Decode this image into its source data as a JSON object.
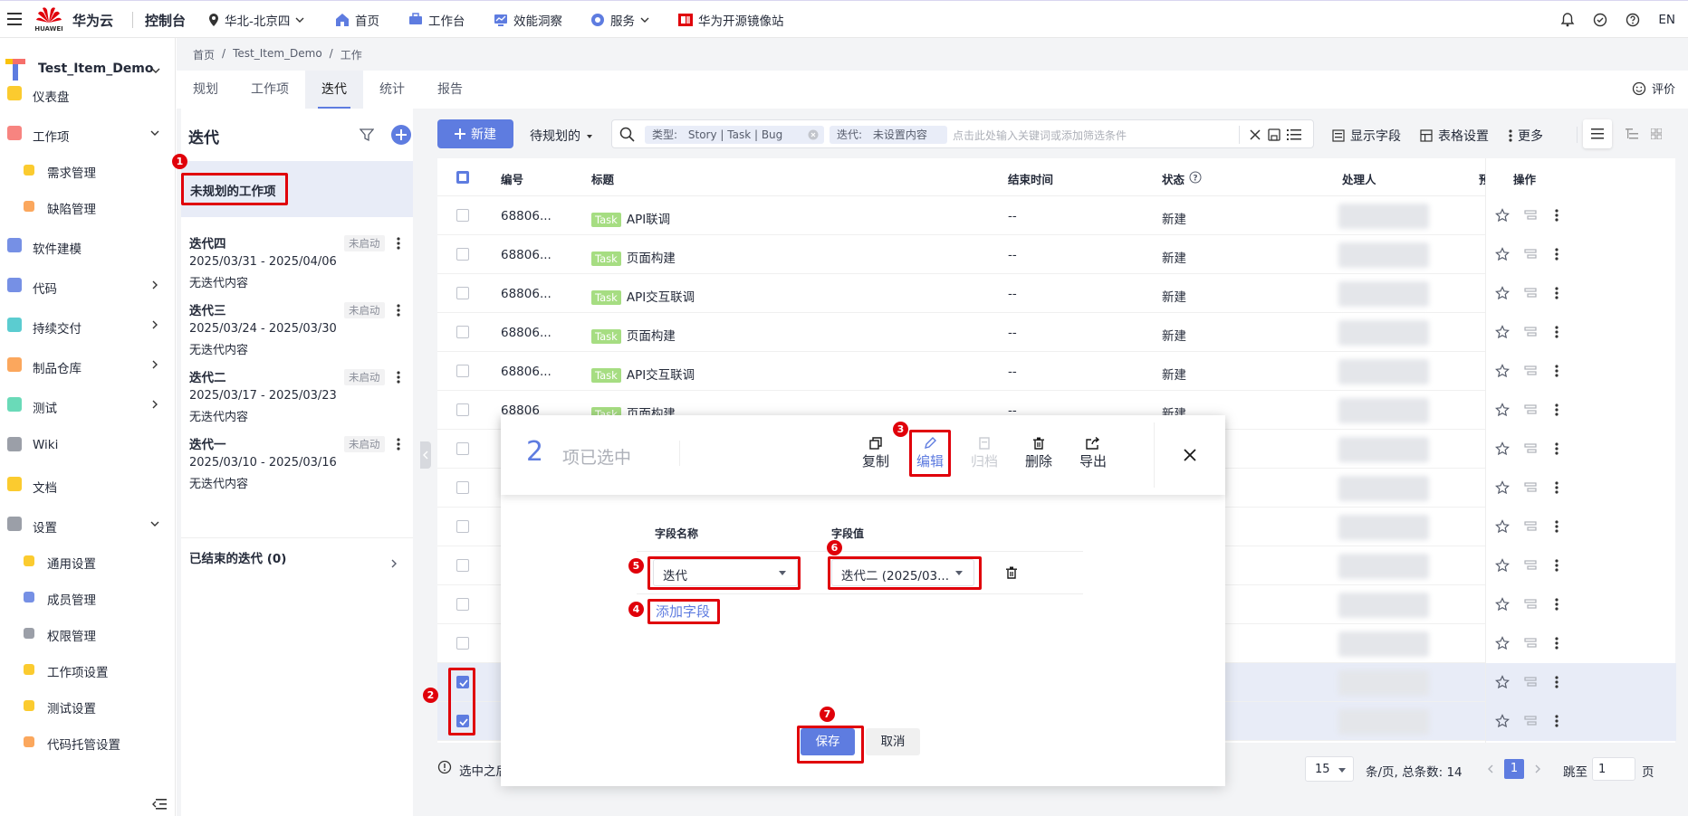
{
  "topbar": {
    "brand": "华为云",
    "logo_text": "HUAWEI",
    "console": "控制台",
    "region": "华北-北京四",
    "home": "首页",
    "workbench": "工作台",
    "efficiency": "效能洞察",
    "services": "服务",
    "mirror": "华为开源镜像站",
    "lang": "EN"
  },
  "sidebar": {
    "project": "Test_Item_Demo",
    "items": [
      {
        "label": "仪表盘"
      },
      {
        "label": "工作项"
      },
      {
        "label": "需求管理"
      },
      {
        "label": "缺陷管理"
      },
      {
        "label": "软件建模"
      },
      {
        "label": "代码"
      },
      {
        "label": "持续交付"
      },
      {
        "label": "制品仓库"
      },
      {
        "label": "测试"
      },
      {
        "label": "Wiki"
      },
      {
        "label": "文档"
      },
      {
        "label": "设置"
      },
      {
        "label": "通用设置"
      },
      {
        "label": "成员管理"
      },
      {
        "label": "权限管理"
      },
      {
        "label": "工作项设置"
      },
      {
        "label": "测试设置"
      },
      {
        "label": "代码托管设置"
      }
    ]
  },
  "breadcrumb": [
    "首页",
    "Test_Item_Demo",
    "工作"
  ],
  "tabs": [
    "规划",
    "工作项",
    "迭代",
    "统计",
    "报告"
  ],
  "rate": "评价",
  "iterations": {
    "title": "迭代",
    "unplanned": "未规划的工作项",
    "list": [
      {
        "name": "迭代四",
        "dates": "2025/03/31 - 2025/04/06",
        "content": "无迭代内容",
        "status": "未启动"
      },
      {
        "name": "迭代三",
        "dates": "2025/03/24 - 2025/03/30",
        "content": "无迭代内容",
        "status": "未启动"
      },
      {
        "name": "迭代二",
        "dates": "2025/03/17 - 2025/03/23",
        "content": "无迭代内容",
        "status": "未启动"
      },
      {
        "name": "迭代一",
        "dates": "2025/03/10 - 2025/03/16",
        "content": "无迭代内容",
        "status": "未启动"
      }
    ],
    "ended": "已结束的迭代 (0)"
  },
  "toolbar": {
    "new": "新建",
    "pending": "待规划的",
    "chip_type_label": "类型:",
    "chip_type_value": "Story | Task | Bug",
    "chip_iter_label": "迭代:",
    "chip_iter_value": "未设置内容",
    "search_placeholder": "点击此处输入关键词或添加筛选条件",
    "show_fields": "显示字段",
    "table_settings": "表格设置",
    "more": "更多"
  },
  "table": {
    "headers": {
      "id": "编号",
      "title": "标题",
      "end": "结束时间",
      "status": "状态",
      "assignee": "处理人",
      "extra": "预",
      "ops": "操作"
    },
    "rows": [
      {
        "id": "68806...",
        "tag": "Task",
        "title": "API联调",
        "end": "--",
        "status": "新建"
      },
      {
        "id": "68806...",
        "tag": "Task",
        "title": "页面构建",
        "end": "--",
        "status": "新建"
      },
      {
        "id": "68806...",
        "tag": "Task",
        "title": "API交互联调",
        "end": "--",
        "status": "新建"
      },
      {
        "id": "68806...",
        "tag": "Task",
        "title": "页面构建",
        "end": "--",
        "status": "新建"
      },
      {
        "id": "68806...",
        "tag": "Task",
        "title": "API交互联调",
        "end": "--",
        "status": "新建"
      },
      {
        "id": "68806",
        "tag": "Task",
        "title": "页面构建",
        "end": "--",
        "status": "新建"
      }
    ]
  },
  "pager": {
    "hint": "选中之后",
    "size": "15",
    "per_page": "条/页, 总条数: 14",
    "page": "1",
    "jump": "跳至",
    "jump_value": "1",
    "page_unit": "页"
  },
  "batch": {
    "count": "2",
    "selected": "项已选中",
    "copy": "复制",
    "edit": "编辑",
    "archive": "归档",
    "delete": "删除",
    "export": "导出",
    "field_name_header": "字段名称",
    "field_value_header": "字段值",
    "field_name": "迭代",
    "field_value": "迭代二 (2025/03...",
    "add_field": "添加字段",
    "save": "保存",
    "cancel": "取消"
  },
  "markers": [
    "1",
    "2",
    "3",
    "4",
    "5",
    "6",
    "7"
  ]
}
